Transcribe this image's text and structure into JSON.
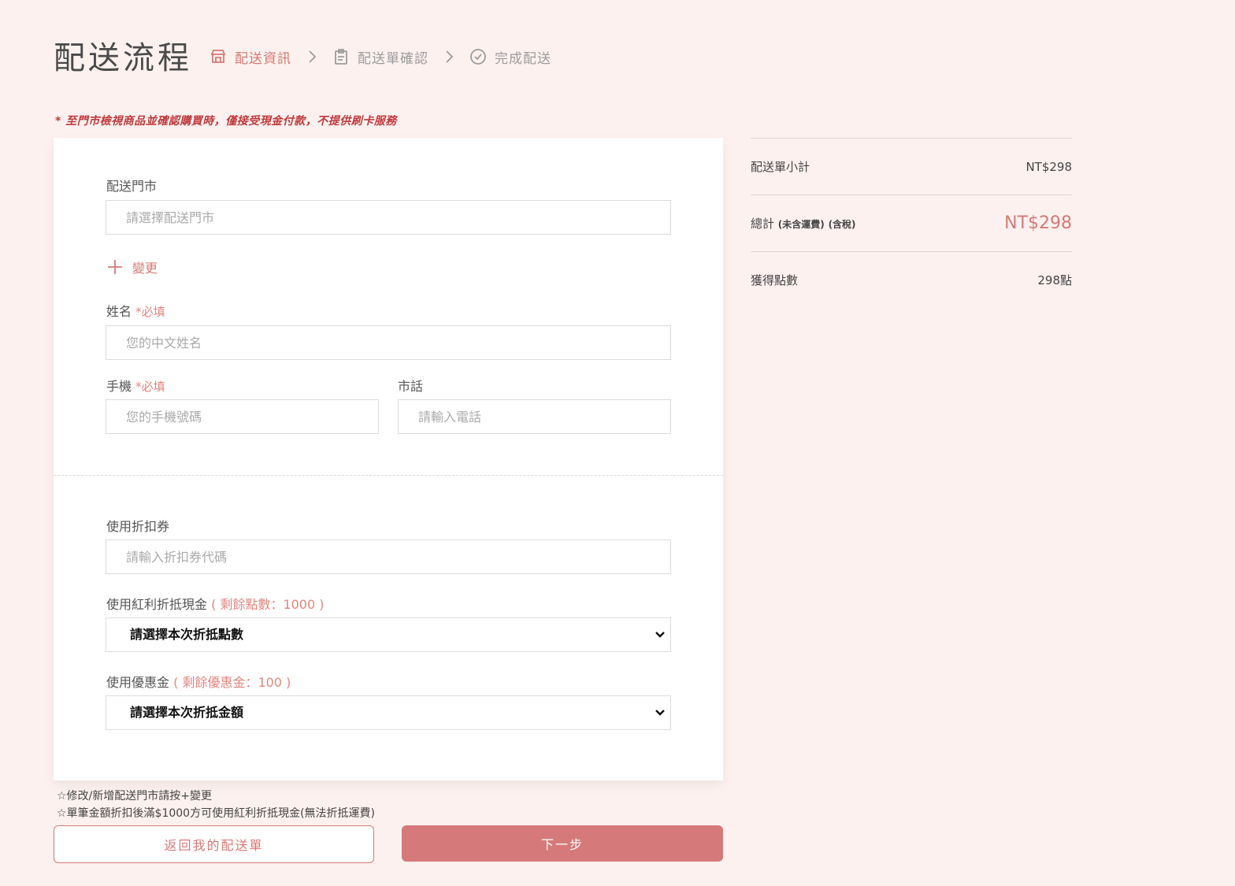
{
  "header": {
    "title": "配送流程",
    "steps": [
      {
        "label": "配送資訊",
        "icon": "store-icon"
      },
      {
        "label": "配送單確認",
        "icon": "clipboard-icon"
      },
      {
        "label": "完成配送",
        "icon": "check-circle-icon"
      }
    ]
  },
  "notice": "* 至門市檢視商品並確認購買時，僅接受現金付款，不提供刷卡服務",
  "form": {
    "store": {
      "label": "配送門市",
      "placeholder": "請選擇配送門市"
    },
    "change_label": "變更",
    "name": {
      "label": "姓名",
      "required": "*必填",
      "placeholder": "您的中文姓名"
    },
    "mobile": {
      "label": "手機",
      "required": "*必填",
      "placeholder": "您的手機號碼"
    },
    "phone": {
      "label": "市話",
      "placeholder": "請輸入電話"
    },
    "coupon": {
      "label": "使用折扣券",
      "placeholder": "請輸入折扣券代碼"
    },
    "points": {
      "label": "使用紅利折抵現金",
      "hint": "( 剩餘點數：1000 )",
      "selected": "請選擇本次折抵點數"
    },
    "credit": {
      "label": "使用優惠金",
      "hint": "( 剩餘優惠金：100 )",
      "selected": "請選擇本次折抵金額"
    }
  },
  "summary": {
    "subtotal_label": "配送單小計",
    "subtotal_value": "NT$298",
    "total_label": "總計",
    "total_note1": "(未含運費)",
    "total_note2": "(含稅)",
    "total_value": "NT$298",
    "points_label": "獲得點數",
    "points_value": "298點"
  },
  "notes": [
    "☆修改/新增配送門市請按+變更",
    "☆單筆金額折扣後滿$1000方可使用紅利折抵現金(無法折抵運費)"
  ],
  "buttons": {
    "back": "返回我的配送單",
    "next": "下一步"
  },
  "colors": {
    "accent": "#d77a76",
    "background": "#fcf1ef",
    "notice": "#c0393b"
  }
}
